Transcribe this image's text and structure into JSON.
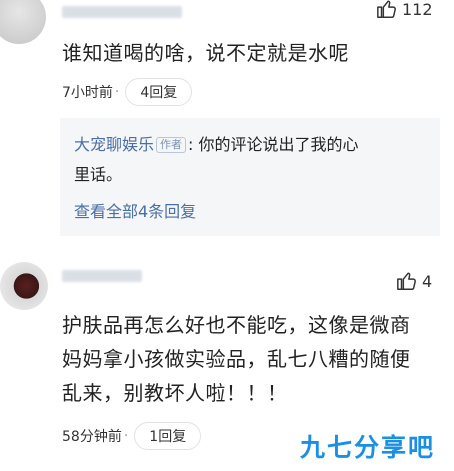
{
  "comment1": {
    "likes": "112",
    "text": "谁知道喝的啥，说不定就是水呢",
    "time": "7小时前",
    "replies_label": "4回复"
  },
  "reply": {
    "author": "大宠聊娱乐",
    "tag": "作者",
    "text_line1": ": 你的评论说出了我的心",
    "text_line2": "里话。",
    "view_all": "查看全部4条回复"
  },
  "comment2": {
    "likes": "4",
    "line1": "护肤品再怎么好也不能吃，这像是微商",
    "line2": "妈妈拿小孩做实验品，乱七八糟的随便",
    "line3": "乱来，别教坏人啦！！！",
    "time": "58分钟前",
    "replies_label": "1回复"
  },
  "watermark": "九七分享吧",
  "icons": [
    "thumbs-up-icon"
  ],
  "colors": {
    "link": "#4a6fa5",
    "watermark": "#1a8fe3"
  }
}
